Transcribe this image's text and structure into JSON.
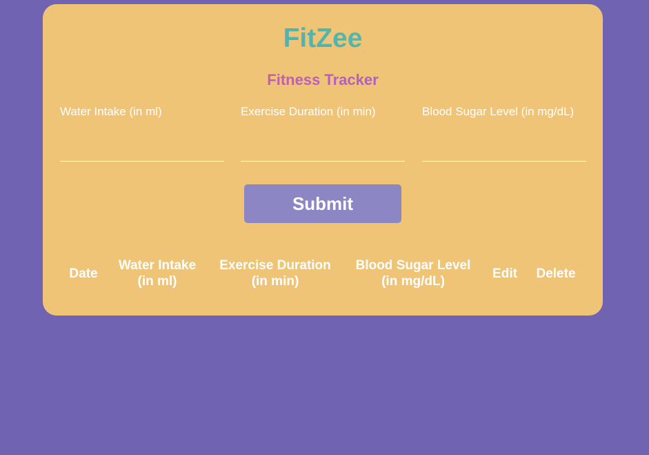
{
  "app": {
    "title": "FitZee",
    "subtitle": "Fitness Tracker"
  },
  "form": {
    "fields": [
      {
        "label": "Water Intake (in ml)",
        "value": ""
      },
      {
        "label": "Exercise Duration (in min)",
        "value": ""
      },
      {
        "label": "Blood Sugar Level (in mg/dL)",
        "value": ""
      }
    ],
    "submit_label": "Submit"
  },
  "table": {
    "headers": [
      "Date",
      "Water Intake\n(in ml)",
      "Exercise Duration\n(in min)",
      "Blood Sugar Level\n(in mg/dL)",
      "Edit",
      "Delete"
    ],
    "rows": []
  },
  "colors": {
    "background": "#6f63b2",
    "card": "#f0c477",
    "button": "#8c86c4",
    "text": "#ffffff"
  }
}
